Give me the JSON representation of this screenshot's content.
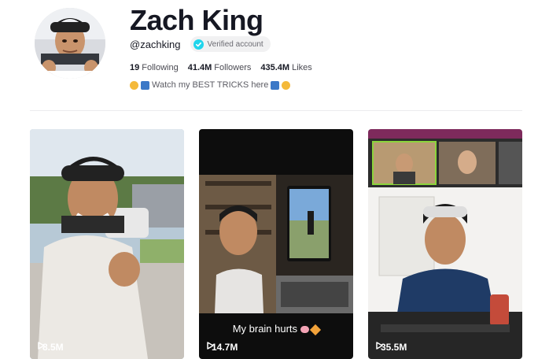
{
  "profile": {
    "name": "Zach King",
    "handle": "@zachking",
    "verified_label": "Verified account",
    "avatar_icon": "profile-avatar",
    "verified_icon": "check-icon",
    "accent_color": "#20d5ec"
  },
  "stats": [
    {
      "value": "19",
      "label": "Following"
    },
    {
      "value": "41.4M",
      "label": "Followers"
    },
    {
      "value": "435.4M",
      "label": "Likes"
    }
  ],
  "bio": {
    "text": "Watch my BEST TRICKS here",
    "leading_icons": [
      "clapping-hands-emoji",
      "arrow-down-right-emoji"
    ],
    "trailing_icons": [
      "arrow-down-left-emoji",
      "clapping-hands-emoji"
    ]
  },
  "videos": [
    {
      "views": "8.5M",
      "caption": ""
    },
    {
      "views": "14.7M",
      "caption": "My brain hurts"
    },
    {
      "views": "35.5M",
      "caption": ""
    }
  ],
  "video_caption_emoji": [
    "brain-emoji",
    "explosion-emoji"
  ]
}
